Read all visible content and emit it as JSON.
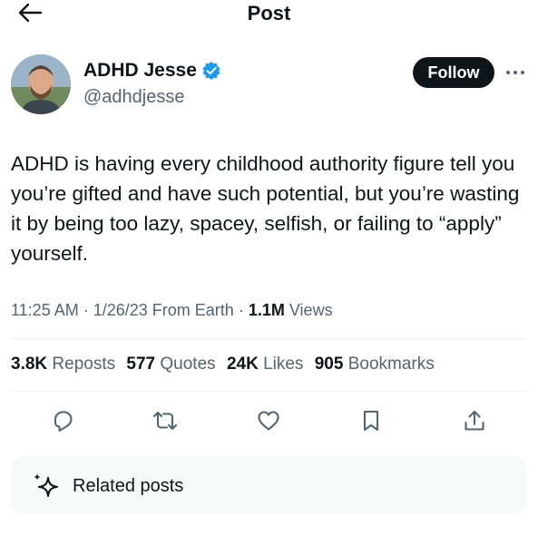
{
  "header": {
    "title": "Post",
    "back_icon": "arrow-left-icon"
  },
  "author": {
    "display_name": "ADHD Jesse",
    "handle": "@adhdjesse",
    "verified_icon": "verified-badge-icon",
    "verified_color": "#1d9bf0"
  },
  "follow_button": {
    "label": "Follow"
  },
  "more_icon": "more-horizontal-icon",
  "tweet": {
    "text": "ADHD is having every childhood authority figure tell you you’re gifted and have such potential, but you’re wasting it by being too lazy, spacey, selfish, or failing to “apply” yourself."
  },
  "meta": {
    "time": "11:25 AM",
    "sep1": " · ",
    "date": "1/26/23",
    "source": "From Earth",
    "sep2": " · ",
    "views_count": "1.1M",
    "views_label": "Views"
  },
  "stats": {
    "reposts": {
      "count": "3.8K",
      "label": "Reposts"
    },
    "quotes": {
      "count": "577",
      "label": "Quotes"
    },
    "likes": {
      "count": "24K",
      "label": "Likes"
    },
    "bookmarks": {
      "count": "905",
      "label": "Bookmarks"
    }
  },
  "actions": {
    "reply_icon": "reply-icon",
    "repost_icon": "repost-icon",
    "like_icon": "heart-icon",
    "bookmark_icon": "bookmark-icon",
    "share_icon": "share-icon"
  },
  "related": {
    "icon": "sparkle-icon",
    "label": "Related posts"
  },
  "colors": {
    "text_primary": "#0f1419",
    "text_secondary": "#536471",
    "follow_bg": "#0f1419",
    "panel_bg": "#f7f9f9"
  }
}
